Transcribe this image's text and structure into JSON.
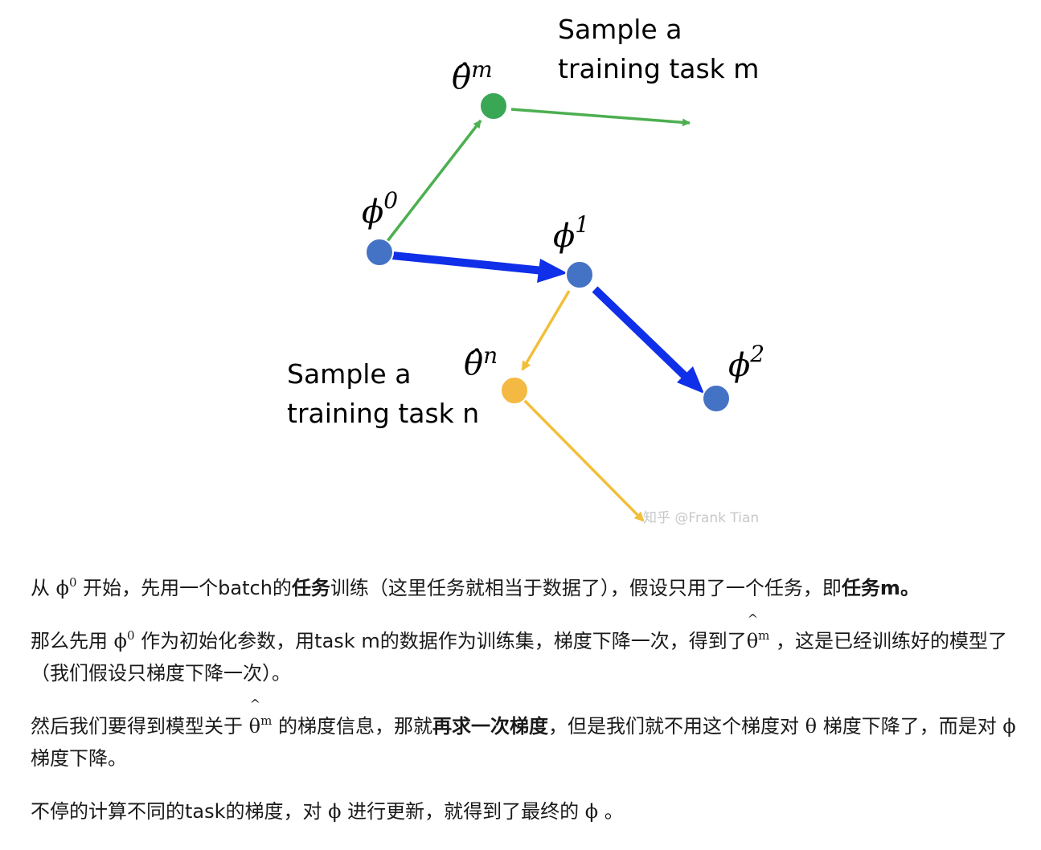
{
  "figure": {
    "label_top": [
      "Sample a",
      "training task m"
    ],
    "label_bottom": [
      "Sample a",
      "training task n"
    ],
    "node_labels": {
      "theta_m": {
        "base": "θ̂",
        "sup": "m"
      },
      "theta_n": {
        "base": "θ̂",
        "sup": "n"
      },
      "phi_0": {
        "base": "ϕ",
        "sup": "0"
      },
      "phi_1": {
        "base": "ϕ",
        "sup": "1"
      },
      "phi_2": {
        "base": "ϕ",
        "sup": "2"
      }
    },
    "watermark": "知乎 @Frank Tian",
    "colors": {
      "blue_node": "#4472c4",
      "blue_arrow": "#0f2fe8",
      "green": "#4caf50",
      "green_node": "#3aa755",
      "orange": "#f2bf3a",
      "orange_node": "#f4b942"
    }
  },
  "article": {
    "p1": {
      "t1": "从 ",
      "phi": "ϕ",
      "sup": "0",
      "t2": " 开始，先用一个batch的",
      "b1": "任务",
      "t3": "训练（这里任务就相当于数据了），假设只用了一个任务，即",
      "b2": "任务m。"
    },
    "p2": {
      "t1": "那么先用 ",
      "phi": "ϕ",
      "sup": "0",
      "t2": " 作为初始化参数，用task m的数据作为训练集，梯度下降一次，得到了",
      "theta": "θ",
      "sup2": "m",
      "t3": " ，这是已经训练好的模型了（我们假设只梯度下降一次）。"
    },
    "p3": {
      "t1": "然后我们要得到模型关于 ",
      "theta": "θ",
      "sup": "m",
      "t2": " 的梯度信息，那就",
      "b1": "再求一次梯度",
      "t3": "，但是我们就不用这个梯度对 ",
      "theta2": "θ",
      "t4": " 梯度下降了，而是对 ",
      "phi": "ϕ",
      "t5": " 梯度下降。"
    },
    "p4": {
      "t1": "不停的计算不同的task的梯度，对 ",
      "phi": "ϕ",
      "t2": " 进行更新，就得到了最终的 ",
      "phi2": "ϕ",
      "t3": " 。"
    }
  }
}
